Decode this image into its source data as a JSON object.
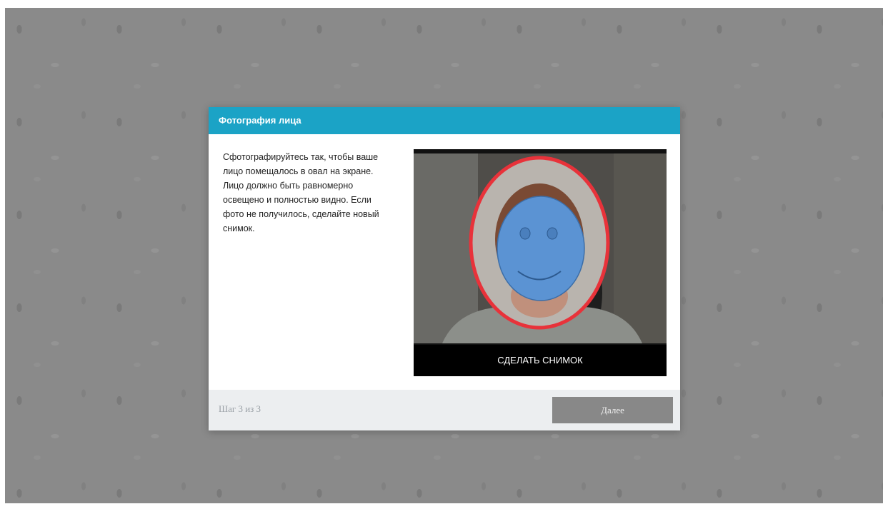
{
  "dialog": {
    "title": "Фотография лица",
    "instructions": "Сфотографируйтесь так, чтобы ваше лицо помещалось в овал на экране. Лицо должно быть равномерно освещено и полностью видно. Если фото не получилось, сделайте новый снимок.",
    "camera": {
      "capture_label": "СДЕЛАТЬ СНИМОК",
      "overlay_icon": "smiley-face-icon",
      "guide_color": "#e8323a",
      "face_color": "#5b93d3"
    },
    "footer": {
      "step_label": "Шаг 3 из 3",
      "next_label": "Далее"
    }
  },
  "colors": {
    "header": "#1ba3c6",
    "next_button": "#888888",
    "footer": "#eceef0"
  }
}
